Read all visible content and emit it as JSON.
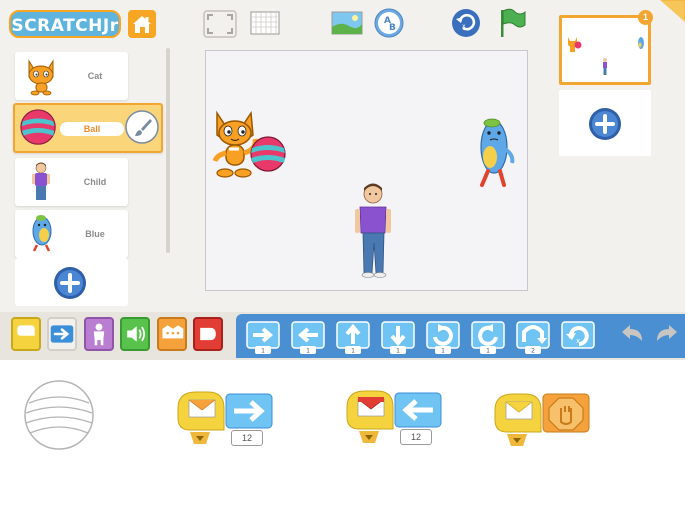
{
  "app": {
    "logo_text": "SCRATCHJr"
  },
  "toolbar": {
    "home_icon": "home-icon",
    "fullscreen_icon": "fullscreen-icon",
    "grid_icon": "grid-icon",
    "background_icon": "background-icon",
    "text_icon": "text-icon",
    "text_icon_letters": "A B",
    "reset_icon": "reset-icon",
    "green_flag_icon": "green-flag-icon"
  },
  "sprites": {
    "items": [
      {
        "label": "Cat"
      },
      {
        "label": "Ball"
      },
      {
        "label": "Child"
      },
      {
        "label": "Blue"
      }
    ],
    "add_icon": "plus-icon"
  },
  "pages": {
    "current_page_number": "1",
    "add_icon": "plus-icon"
  },
  "categories": [
    {
      "name": "triggering",
      "color": "#f5d33f"
    },
    {
      "name": "motion",
      "color": "#3b8fd9"
    },
    {
      "name": "looks",
      "color": "#b97dd1"
    },
    {
      "name": "sound",
      "color": "#58c24c"
    },
    {
      "name": "control",
      "color": "#f5a23d"
    },
    {
      "name": "end",
      "color": "#e23d35"
    }
  ],
  "palette_blocks": [
    {
      "name": "move-right",
      "value": "1"
    },
    {
      "name": "move-left",
      "value": "1"
    },
    {
      "name": "move-up",
      "value": "1"
    },
    {
      "name": "move-down",
      "value": "1"
    },
    {
      "name": "turn-right",
      "value": "1"
    },
    {
      "name": "turn-left",
      "value": "1"
    },
    {
      "name": "hop",
      "value": "2"
    },
    {
      "name": "go-home",
      "value": ""
    }
  ],
  "scripts": [
    {
      "trigger": "start-on-message-orange",
      "action": "move-right",
      "value": "12"
    },
    {
      "trigger": "start-on-message-red",
      "action": "move-left",
      "value": "12"
    },
    {
      "trigger": "start-on-message-yellow",
      "action": "stop",
      "value": ""
    }
  ]
}
